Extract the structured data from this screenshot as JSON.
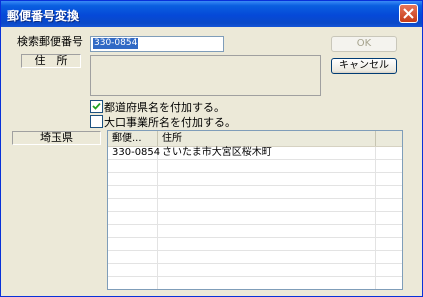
{
  "window": {
    "title": "郵便番号変換"
  },
  "labels": {
    "zip_label": "検索郵便番号",
    "address_label": "住　所",
    "prefecture": "埼玉県"
  },
  "zip_input": {
    "value": "330-0854"
  },
  "buttons": {
    "ok": "OK",
    "cancel": "キャンセル"
  },
  "checkboxes": [
    {
      "label": "都道府県名を付加する。",
      "checked": true
    },
    {
      "label": "大口事業所名を付加する。",
      "checked": false
    }
  ],
  "list": {
    "columns": [
      "郵便...",
      "住所"
    ],
    "rows": [
      {
        "zip": "330-0854",
        "address": "さいたま市大宮区桜木町"
      }
    ]
  }
}
